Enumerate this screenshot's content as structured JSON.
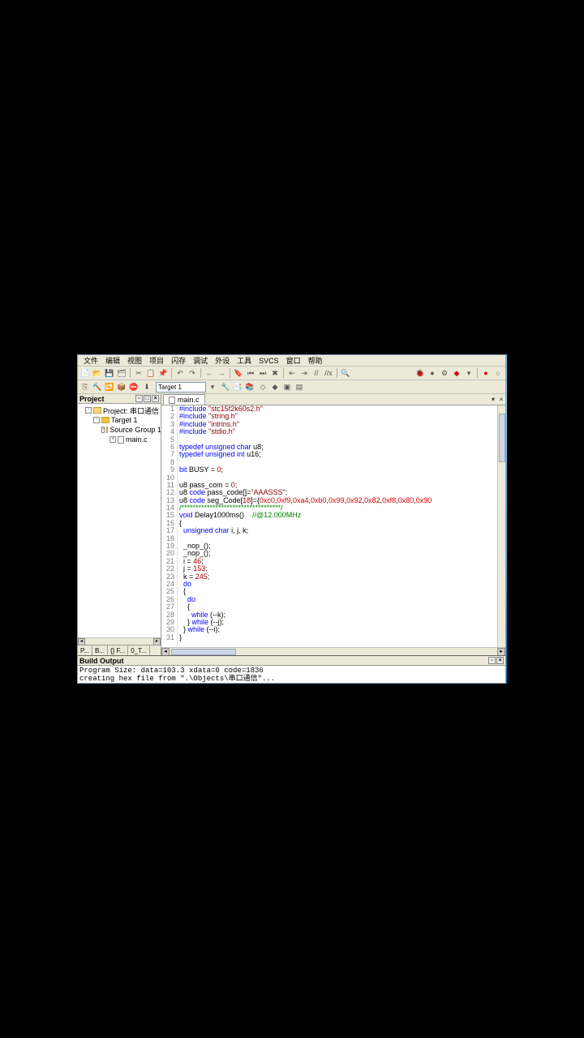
{
  "menu": [
    "文件",
    "编辑",
    "视图",
    "项目",
    "闪存",
    "调试",
    "外设",
    "工具",
    "SVCS",
    "窗口",
    "帮助"
  ],
  "target_label": "Target 1",
  "project_pane": {
    "title": "Project",
    "root": "Project: 串口通信",
    "target": "Target 1",
    "group": "Source Group 1",
    "file": "main.c"
  },
  "project_tabs": [
    "P...",
    "B...",
    "{} F...",
    "0_T..."
  ],
  "editor_tab": "main.c",
  "code_lines": [
    {
      "n": 1,
      "segs": [
        {
          "t": "#include ",
          "c": "kw"
        },
        {
          "t": "\"stc15f2k60s2.h\"",
          "c": "str"
        }
      ]
    },
    {
      "n": 2,
      "segs": [
        {
          "t": "#include ",
          "c": "kw"
        },
        {
          "t": "\"string.h\"",
          "c": "str"
        }
      ]
    },
    {
      "n": 3,
      "segs": [
        {
          "t": "#include ",
          "c": "kw"
        },
        {
          "t": "\"intrins.h\"",
          "c": "str"
        }
      ]
    },
    {
      "n": 4,
      "segs": [
        {
          "t": "#include ",
          "c": "kw"
        },
        {
          "t": "\"stdio.h\"",
          "c": "str"
        }
      ]
    },
    {
      "n": 5,
      "segs": [
        {
          "t": " "
        }
      ]
    },
    {
      "n": 6,
      "segs": [
        {
          "t": "typedef unsigned char",
          "c": "kw"
        },
        {
          "t": " u8;"
        }
      ]
    },
    {
      "n": 7,
      "segs": [
        {
          "t": "typedef unsigned int",
          "c": "kw"
        },
        {
          "t": " u16;"
        }
      ]
    },
    {
      "n": 8,
      "segs": [
        {
          "t": " "
        }
      ]
    },
    {
      "n": 9,
      "segs": [
        {
          "t": "bit",
          "c": "kw"
        },
        {
          "t": " BUSY = "
        },
        {
          "t": "0",
          "c": "num"
        },
        {
          "t": ";"
        }
      ]
    },
    {
      "n": 10,
      "segs": [
        {
          "t": " "
        }
      ]
    },
    {
      "n": 11,
      "segs": [
        {
          "t": "u8 pass_com = "
        },
        {
          "t": "0",
          "c": "num"
        },
        {
          "t": ";"
        }
      ]
    },
    {
      "n": 12,
      "segs": [
        {
          "t": "u8 "
        },
        {
          "t": "code",
          "c": "kw"
        },
        {
          "t": " pass_code[]="
        },
        {
          "t": "\"AAASSS\"",
          "c": "str"
        },
        {
          "t": ";"
        }
      ]
    },
    {
      "n": 13,
      "segs": [
        {
          "t": "u8 "
        },
        {
          "t": "code",
          "c": "kw"
        },
        {
          "t": " seg_Code["
        },
        {
          "t": "18",
          "c": "num"
        },
        {
          "t": "]={"
        },
        {
          "t": "0xc0",
          "c": "hl"
        },
        {
          "t": ","
        },
        {
          "t": "0xf9",
          "c": "hl"
        },
        {
          "t": ","
        },
        {
          "t": "0xa4",
          "c": "hl"
        },
        {
          "t": ","
        },
        {
          "t": "0xb0",
          "c": "hl"
        },
        {
          "t": ","
        },
        {
          "t": "0x99",
          "c": "hl"
        },
        {
          "t": ","
        },
        {
          "t": "0x92",
          "c": "hl"
        },
        {
          "t": ","
        },
        {
          "t": "0x82",
          "c": "hl"
        },
        {
          "t": ","
        },
        {
          "t": "0xf8",
          "c": "hl"
        },
        {
          "t": ","
        },
        {
          "t": "0x80",
          "c": "hl"
        },
        {
          "t": ","
        },
        {
          "t": "0x90",
          "c": "hl"
        }
      ]
    },
    {
      "n": 14,
      "segs": [
        {
          "t": "/***********************************/",
          "c": "cmt"
        }
      ]
    },
    {
      "n": 15,
      "segs": [
        {
          "t": "void",
          "c": "kw"
        },
        {
          "t": " Delay1000ms()    "
        },
        {
          "t": "//@12.000MHz",
          "c": "cmt"
        }
      ]
    },
    {
      "n": 16,
      "segs": [
        {
          "t": "{"
        }
      ]
    },
    {
      "n": 17,
      "segs": [
        {
          "t": "  "
        },
        {
          "t": "unsigned char",
          "c": "kw"
        },
        {
          "t": " i, j, k;"
        }
      ]
    },
    {
      "n": 18,
      "segs": [
        {
          "t": " "
        }
      ]
    },
    {
      "n": 19,
      "segs": [
        {
          "t": "  _nop_();"
        }
      ]
    },
    {
      "n": 20,
      "segs": [
        {
          "t": "  _nop_();"
        }
      ]
    },
    {
      "n": 21,
      "segs": [
        {
          "t": "  i = "
        },
        {
          "t": "46",
          "c": "num"
        },
        {
          "t": ";"
        }
      ]
    },
    {
      "n": 22,
      "segs": [
        {
          "t": "  j = "
        },
        {
          "t": "153",
          "c": "num"
        },
        {
          "t": ";"
        }
      ]
    },
    {
      "n": 23,
      "segs": [
        {
          "t": "  k = "
        },
        {
          "t": "245",
          "c": "num"
        },
        {
          "t": ";"
        }
      ]
    },
    {
      "n": 24,
      "segs": [
        {
          "t": "  "
        },
        {
          "t": "do",
          "c": "kw"
        }
      ]
    },
    {
      "n": 25,
      "segs": [
        {
          "t": "  {"
        }
      ]
    },
    {
      "n": 26,
      "segs": [
        {
          "t": "    "
        },
        {
          "t": "do",
          "c": "kw"
        }
      ]
    },
    {
      "n": 27,
      "segs": [
        {
          "t": "    {"
        }
      ]
    },
    {
      "n": 28,
      "segs": [
        {
          "t": "      "
        },
        {
          "t": "while",
          "c": "kw"
        },
        {
          "t": " (--k);"
        }
      ]
    },
    {
      "n": 29,
      "segs": [
        {
          "t": "    } "
        },
        {
          "t": "while",
          "c": "kw"
        },
        {
          "t": " (--j);"
        }
      ]
    },
    {
      "n": 30,
      "segs": [
        {
          "t": "  } "
        },
        {
          "t": "while",
          "c": "kw"
        },
        {
          "t": " (--i);"
        }
      ]
    },
    {
      "n": 31,
      "segs": [
        {
          "t": "}"
        }
      ]
    }
  ],
  "output": {
    "title": "Build Output",
    "lines": [
      "Program Size: data=103.3 xdata=0 code=1836",
      "creating hex file from \".\\Objects\\串口通信\"..."
    ]
  }
}
